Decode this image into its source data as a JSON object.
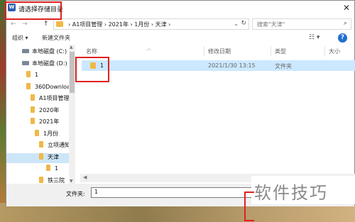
{
  "dialog": {
    "title": "请选择存储目录",
    "app_icon": "W",
    "close_glyph": "✕"
  },
  "address_bar": {
    "nav_back": "←",
    "nav_forward": "→",
    "nav_up": "↑",
    "crumbs": "›  A1项目管理  ›  2021年  ›  1月份  ›  天津  ›",
    "dropdown_glyph": "⌄",
    "refresh_glyph": "↻"
  },
  "search": {
    "placeholder": "搜索\"天津\"",
    "icon": "search-icon",
    "glyph": "⌕"
  },
  "toolbar": {
    "organize_label": "组织 ▾",
    "new_folder_label": "新建文件夹",
    "view_glyph": "☷ ▾",
    "help_glyph": "?"
  },
  "nav_tree": [
    {
      "label": "本地磁盘 (C:)",
      "kind": "drive"
    },
    {
      "label": "本地磁盘 (D:)",
      "kind": "drive"
    },
    {
      "label": "1",
      "kind": "folder"
    },
    {
      "label": "360Downloa",
      "kind": "folder"
    },
    {
      "label": "A1项目管理",
      "kind": "folder"
    },
    {
      "label": "2020年",
      "kind": "folder"
    },
    {
      "label": "2021年",
      "kind": "folder"
    },
    {
      "label": "1月份",
      "kind": "folder"
    },
    {
      "label": "立项通知",
      "kind": "folder"
    },
    {
      "label": "天津",
      "kind": "folder",
      "selected": true
    },
    {
      "label": "1",
      "kind": "folder"
    },
    {
      "label": "铁三院",
      "kind": "folder"
    }
  ],
  "columns": {
    "name": "名称",
    "modified": "修改日期",
    "type": "类型",
    "size": "大小"
  },
  "files": [
    {
      "name": "1",
      "modified": "2021/1/30 13:15",
      "type": "文件夹",
      "selected": true
    }
  ],
  "footer": {
    "folder_label": "文件夹:",
    "folder_value": "1"
  },
  "watermark": "软件技巧",
  "colors": {
    "accent": "#1f6fd0",
    "selection": "#cce8ff",
    "folder": "#f0b848",
    "highlight": "#e02020"
  }
}
